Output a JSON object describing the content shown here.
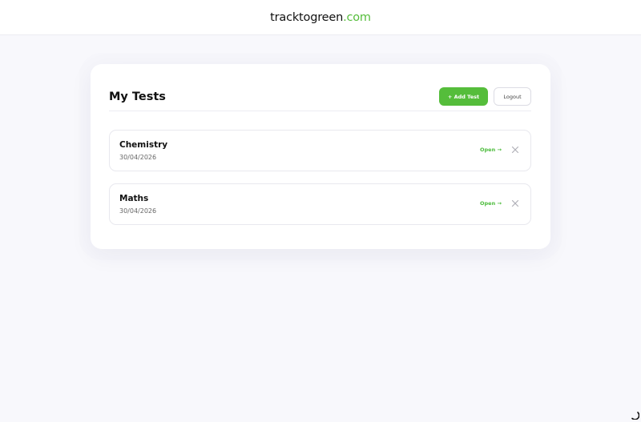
{
  "header": {
    "brand_main": "tracktogreen",
    "brand_tld": ".com"
  },
  "page": {
    "title": "My Tests",
    "add_button_label": "+ Add Test",
    "logout_button_label": "Logout"
  },
  "tests": [
    {
      "name": "Chemistry",
      "date": "30/04/2026",
      "open_label": "Open →"
    },
    {
      "name": "Maths",
      "date": "30/04/2026",
      "open_label": "Open →"
    }
  ],
  "icons": {
    "delete": "close-icon",
    "loading": "spinner-icon"
  },
  "colors": {
    "accent": "#55bd3b",
    "background": "#f8f8fc",
    "card": "#ffffff"
  }
}
